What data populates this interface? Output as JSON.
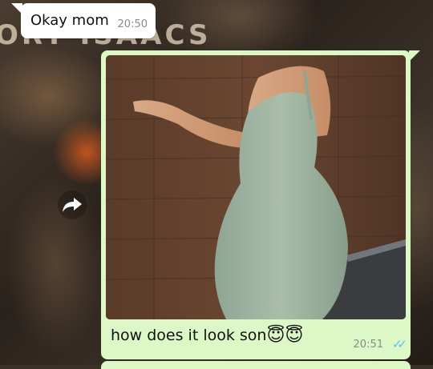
{
  "wallpaper": {
    "text": "ORY ISAACS"
  },
  "messages": [
    {
      "direction": "incoming",
      "text": "Okay mom",
      "time": "20:50"
    },
    {
      "direction": "outgoing",
      "has_photo": true,
      "text": "how does it look son",
      "emoji": "😇😇",
      "time": "20:51",
      "status": "read",
      "status_icon": "double-check-icon",
      "status_color": "#4fc3f7"
    }
  ],
  "colors": {
    "incoming_bubble": "#ffffff",
    "outgoing_bubble": "#dcf8c6",
    "read_ticks": "#4fc3f7"
  }
}
